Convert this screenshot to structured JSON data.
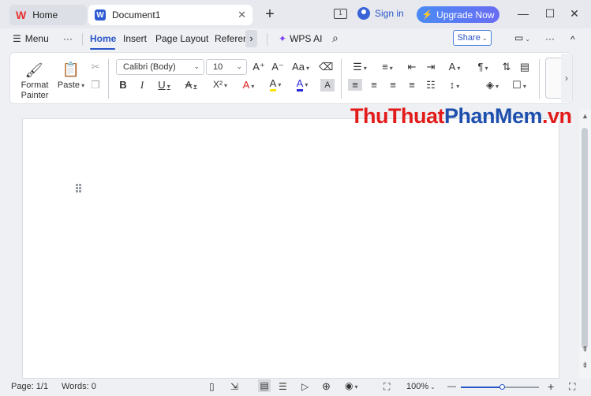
{
  "titlebar": {
    "home_tab": "Home",
    "doc_tab": "Document1",
    "close_glyph": "✕",
    "new_tab_glyph": "+",
    "page_count_badge": "1",
    "sign_in": "Sign in",
    "upgrade": "Upgrade Now",
    "window_controls": {
      "minimize": "—",
      "maximize": "☐",
      "close": "✕"
    }
  },
  "menubar": {
    "menu": "Menu",
    "more": "···",
    "tabs": [
      "Home",
      "Insert",
      "Page Layout",
      "Referer"
    ],
    "active_tab": "Home",
    "more_tabs": "›",
    "wps_ai": "WPS AI",
    "share": "Share",
    "collapse": "^"
  },
  "ribbon": {
    "format_painter": "Format\nPainter",
    "paste": "Paste",
    "font_name": "Calibri (Body)",
    "font_size": "10",
    "bold": "B",
    "italic": "I",
    "underline": "U",
    "strikethrough": "A",
    "superscript": "X²",
    "font_effects": "A",
    "highlight": "A",
    "font_color": "A",
    "char_shading": "A",
    "grow_font": "A⁺",
    "shrink_font": "A⁻",
    "change_case": "Aa"
  },
  "watermark": {
    "part1": "ThuThuat",
    "part2": "PhanMem",
    "part3": ".vn"
  },
  "status": {
    "page": "Page: 1/1",
    "words": "Words: 0",
    "zoom": "100%",
    "zoom_minus": "—",
    "zoom_plus": "+",
    "zoom_level": 0.54
  },
  "colors": {
    "accent": "#2a55c8",
    "upgrade_start": "#4a8bf5",
    "upgrade_end": "#6a6cf3",
    "highlight_yellow": "#ffe600",
    "font_color_red": "#e21b1b"
  }
}
